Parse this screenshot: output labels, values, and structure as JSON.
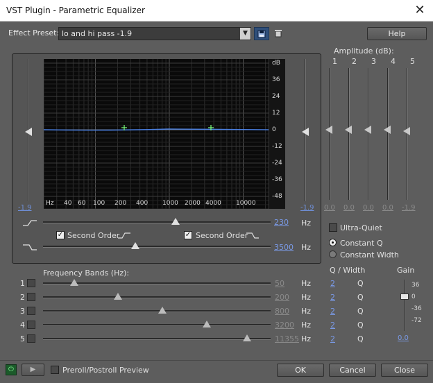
{
  "window": {
    "title": "VST Plugin - Parametric Equalizer",
    "close_glyph": "✕"
  },
  "preset": {
    "label": "Effect Preset:",
    "value": "lo and hi pass -1.9"
  },
  "toolbar": {
    "help_label": "Help",
    "save_icon": "save-icon",
    "delete_icon": "delete-icon"
  },
  "graph": {
    "db_unit": "dB",
    "db_ticks": [
      "36",
      "24",
      "12",
      "0",
      "-12",
      "-24",
      "-36",
      "-48"
    ],
    "freq_ticks": [
      "Hz",
      "40",
      "60",
      "100",
      "200",
      "400",
      "1000",
      "2000",
      "4000",
      "10000"
    ],
    "left_gain_value": "-1.9",
    "right_gain_value": "-1.9",
    "curve_color": "#4a7fe0",
    "point_color": "#7dff7d"
  },
  "highpass": {
    "value": "230",
    "unit": "Hz",
    "second_order_label": "Second Order",
    "second_order_checked": true
  },
  "lowpass": {
    "value": "3500",
    "unit": "Hz",
    "second_order_label": "Second Order",
    "second_order_checked": true
  },
  "amplitude": {
    "title": "Amplitude (dB):",
    "bands": [
      "1",
      "2",
      "3",
      "4",
      "5"
    ],
    "values": [
      "0.0",
      "0.0",
      "0.0",
      "0.0",
      "-1.9"
    ]
  },
  "options": {
    "ultra_quiet_label": "Ultra-Quiet",
    "constant_q_label": "Constant Q",
    "constant_width_label": "Constant Width",
    "constant_q_selected": true
  },
  "frequency_bands": {
    "title": "Frequency Bands (Hz):",
    "unit": "Hz",
    "q_unit": "Q",
    "rows": [
      {
        "num": "1",
        "value": "50",
        "q": "2"
      },
      {
        "num": "2",
        "value": "200",
        "q": "2"
      },
      {
        "num": "3",
        "value": "800",
        "q": "2"
      },
      {
        "num": "4",
        "value": "3200",
        "q": "2"
      },
      {
        "num": "5",
        "value": "11355",
        "q": "2"
      }
    ]
  },
  "q_width": {
    "title": "Q / Width"
  },
  "gain": {
    "title": "Gain",
    "ticks": [
      "36",
      "0",
      "-36",
      "-72"
    ],
    "value": "0.0"
  },
  "footer": {
    "preroll_label": "Preroll/Postroll Preview",
    "ok_label": "OK",
    "cancel_label": "Cancel",
    "close_label": "Close"
  }
}
